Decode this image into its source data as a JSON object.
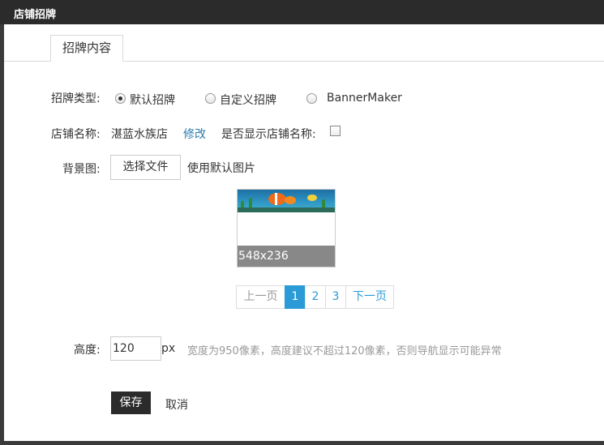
{
  "window": {
    "title": "店铺招牌"
  },
  "tabs": [
    {
      "label": "招牌内容"
    }
  ],
  "form": {
    "type": {
      "label": "招牌类型:",
      "options": [
        {
          "label": "默认招牌",
          "checked": true
        },
        {
          "label": "自定义招牌",
          "checked": false
        },
        {
          "label": "BannerMaker",
          "checked": false
        }
      ]
    },
    "store_name": {
      "label": "店铺名称:",
      "value": "湛蓝水族店",
      "edit_link": "修改",
      "show_label": "是否显示店铺名称:",
      "show_checked": false
    },
    "background": {
      "label": "背景图:",
      "choose_button": "选择文件",
      "default_text": "使用默认图片",
      "thumbnail_caption": "548x236"
    },
    "pagination": {
      "prev": "上一页",
      "pages": [
        "1",
        "2",
        "3"
      ],
      "active_page": "1",
      "next": "下一页"
    },
    "height": {
      "label": "高度:",
      "value": "120",
      "unit": "px",
      "hint": "宽度为950像素，高度建议不超过120像素，否则导航显示可能异常"
    },
    "actions": {
      "save": "保存",
      "cancel": "取消"
    }
  },
  "colors": {
    "titlebar": "#2b2b2b",
    "link": "#2a7ab0",
    "pager_active": "#2a9bd6",
    "save_button": "#2b2b2b"
  }
}
